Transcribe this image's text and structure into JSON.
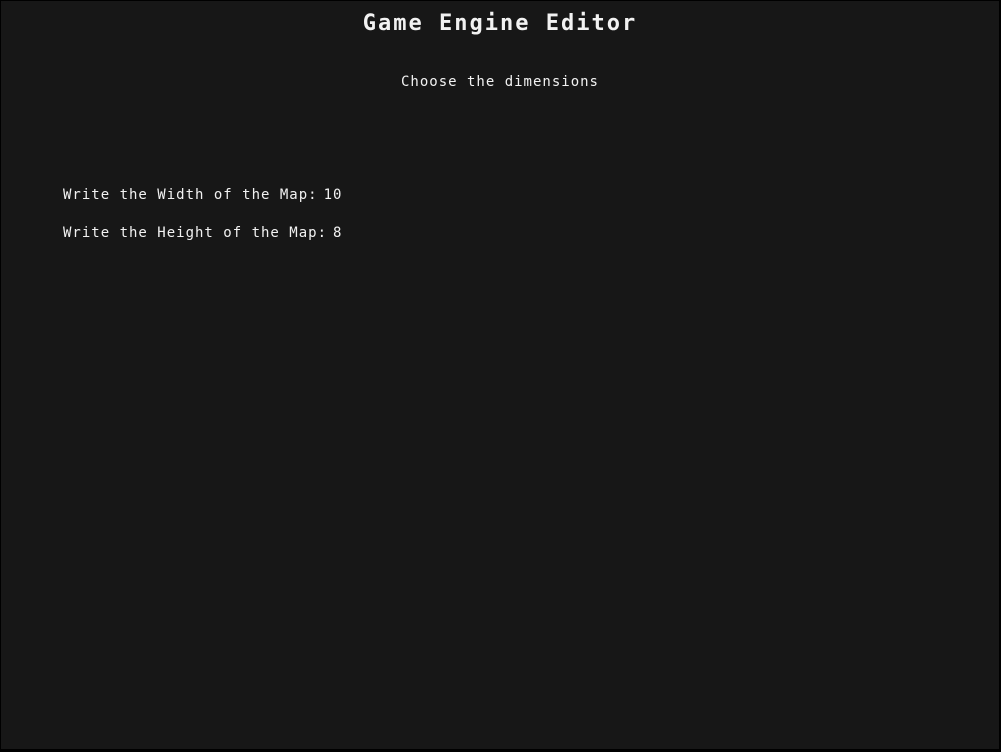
{
  "app": {
    "title": "Game Engine Editor",
    "subtitle": "Choose the dimensions"
  },
  "form": {
    "width": {
      "label": "Write the Width of the Map:",
      "value": "10"
    },
    "height": {
      "label": "Write the Height of the Map:",
      "value": "8"
    }
  },
  "colors": {
    "background": "#171717",
    "text": "#f2f2f2",
    "frame": "#000000"
  }
}
